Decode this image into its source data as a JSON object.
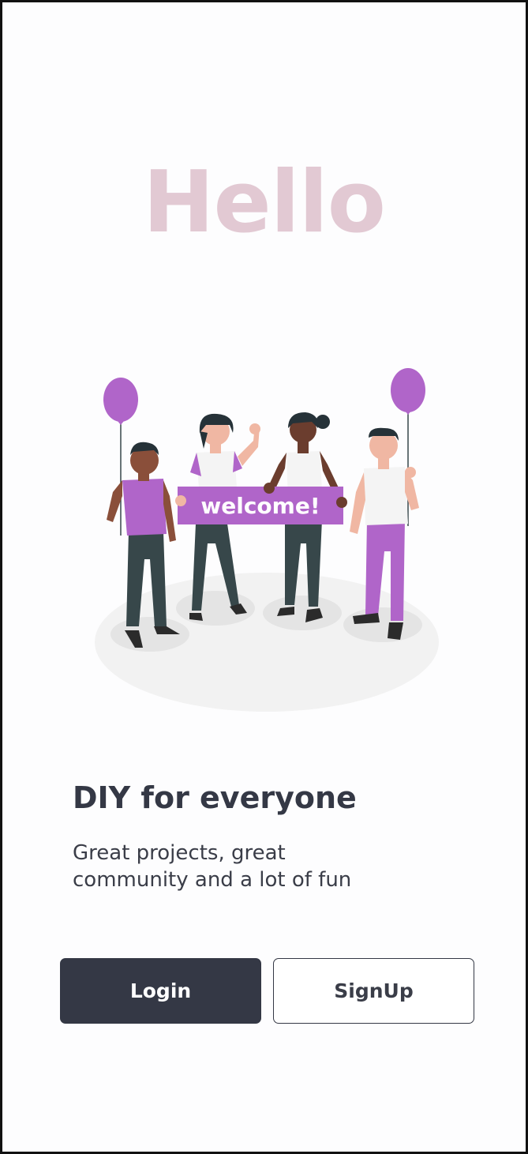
{
  "greeting": "Hello",
  "illustration": {
    "banner_text": "welcome!",
    "colors": {
      "accent": "#b065c9",
      "dark": "#37474a",
      "ground": "#ebebeb"
    }
  },
  "headline": "DIY for everyone",
  "subtext_line1": "Great projects, great",
  "subtext_line2": "community and a lot of fun",
  "buttons": {
    "login": "Login",
    "signup": "SignUp"
  },
  "colors": {
    "greeting": "#e2c9d3",
    "primary": "#343845",
    "background": "#fdfdfe"
  }
}
